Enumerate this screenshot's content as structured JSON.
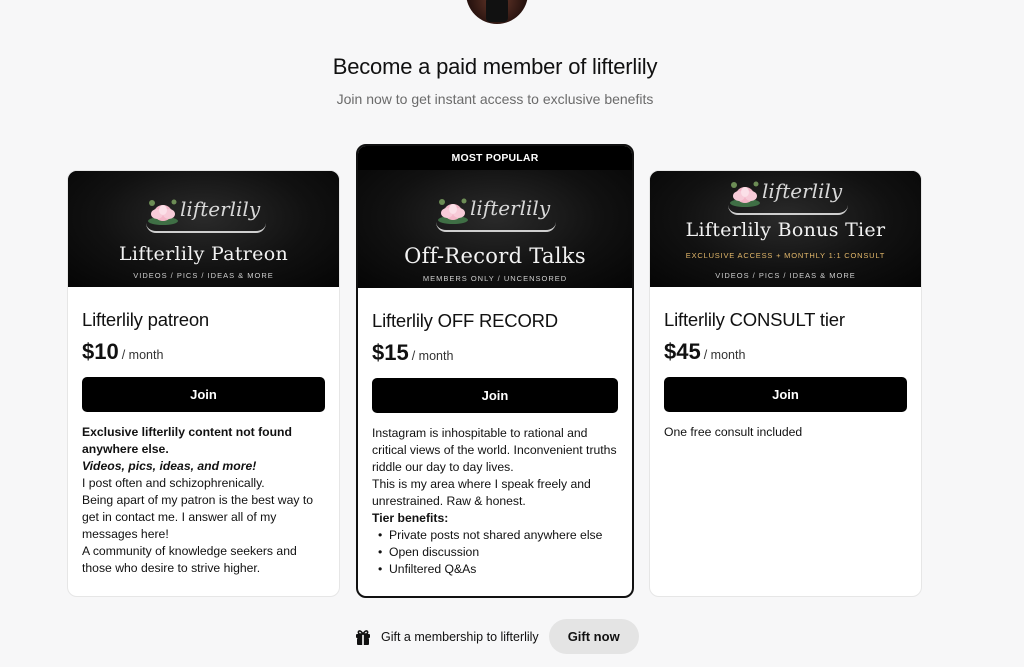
{
  "header": {
    "title": "Become a paid member of lifterlily",
    "subtitle": "Join now to get instant access to exclusive benefits"
  },
  "tiers": [
    {
      "banner_logo": "lifterlily",
      "banner_title": "Lifterlily Patreon",
      "banner_subtitle": "VIDEOS / PICS / IDEAS & MORE",
      "name": "Lifterlily patreon",
      "price": "$10",
      "period": "/ month",
      "join_label": "Join",
      "desc_bold": "Exclusive lifterlily content not found anywhere else.",
      "desc_bold_italic": "Videos, pics, ideas, and more!",
      "desc_lines": [
        "I post often and schizophrenically.",
        "Being apart of my patron is the best way to get in contact me. I answer all of my messages here!",
        "A community of knowledge seekers and those who desire to strive higher."
      ]
    },
    {
      "badge": "MOST POPULAR",
      "banner_logo": "lifterlily",
      "banner_title": "Off-Record Talks",
      "banner_subtitle": "MEMBERS ONLY / UNCENSORED",
      "name": "Lifterlily OFF RECORD",
      "price": "$15",
      "period": "/ month",
      "join_label": "Join",
      "desc_lines": [
        "Instagram is inhospitable to rational and critical views of the world. Inconvenient truths riddle our day to day lives.",
        "This is my area where I speak freely and unrestrained. Raw & honest."
      ],
      "benefits_heading": "Tier benefits:",
      "benefits": [
        "Private posts not shared anywhere else",
        "Open discussion",
        "Unfiltered Q&As"
      ]
    },
    {
      "banner_logo": "lifterlily",
      "banner_title": "Lifterlily Bonus Tier",
      "banner_gold": "EXCLUSIVE ACCESS + MONTHLY 1:1 CONSULT",
      "banner_subtitle": "VIDEOS / PICS / IDEAS & MORE",
      "name": "Lifterlily CONSULT tier",
      "price": "$45",
      "period": "/ month",
      "join_label": "Join",
      "desc_lines": [
        "One free consult included"
      ]
    }
  ],
  "gift": {
    "icon": "gift-icon",
    "text": "Gift a membership to lifterlily",
    "button_label": "Gift now"
  },
  "colors": {
    "background": "#f7f7f8",
    "primary_button": "#000000",
    "gift_button": "#e4e4e4",
    "banner_gold": "#e2b76a"
  }
}
